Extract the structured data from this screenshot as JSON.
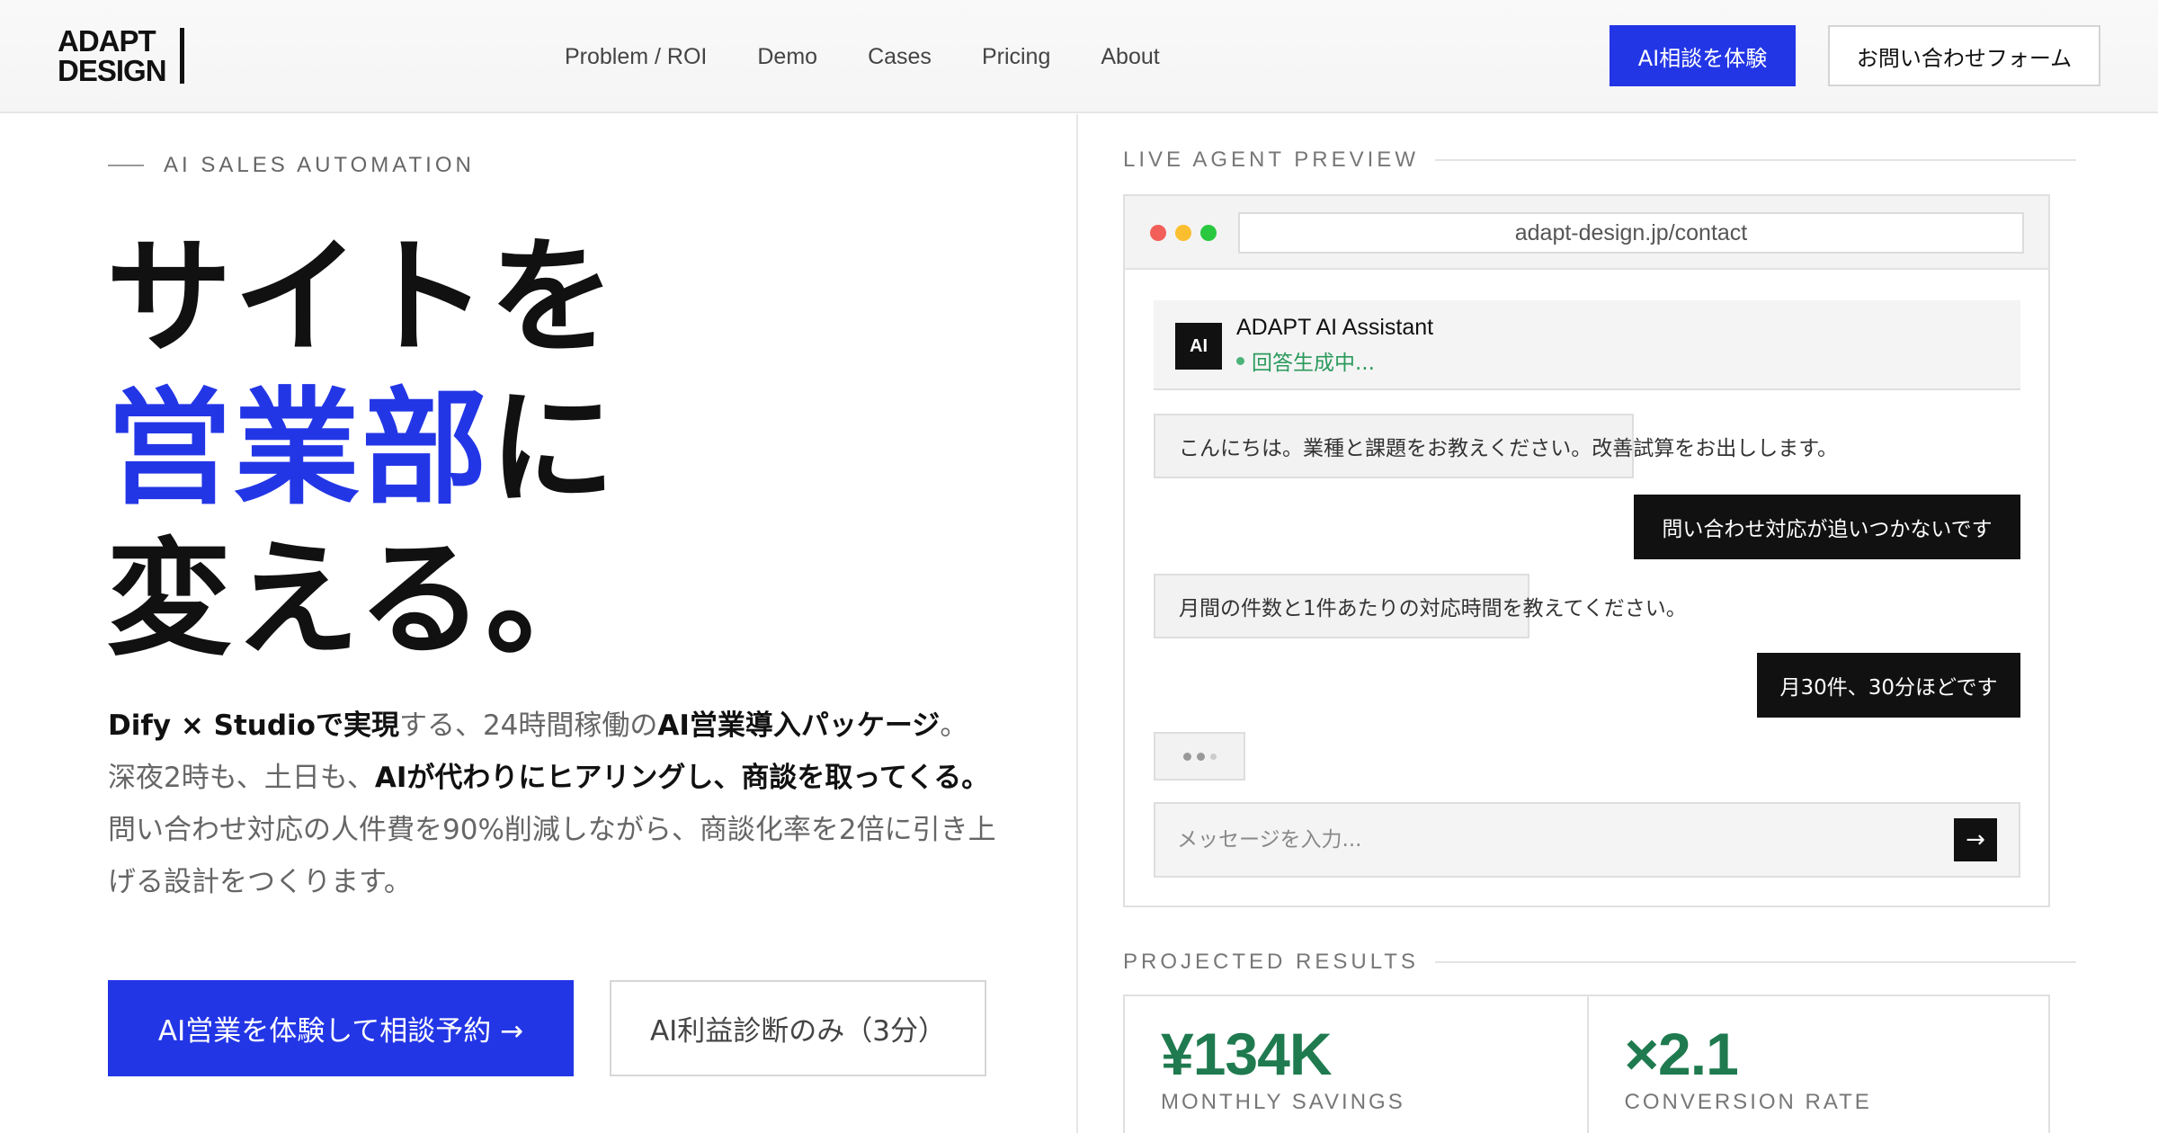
{
  "header": {
    "logo_line1": "ADAPT",
    "logo_line2": "DESIGN",
    "nav": [
      "Problem / ROI",
      "Demo",
      "Cases",
      "Pricing",
      "About"
    ],
    "cta_primary": "AI相談を体験",
    "cta_secondary": "お問い合わせフォーム"
  },
  "hero": {
    "eyebrow": "AI SALES AUTOMATION",
    "headline_line1": "サイトを",
    "headline_accent": "営業部",
    "headline_line2_rest": "に",
    "headline_line3": "変える。",
    "desc": {
      "p1_bold_a": "Dify × Studioで実現",
      "p1_mid": "する、24時間稼働の",
      "p1_bold_b": "AI営業導入パッケージ",
      "p1_end": "。",
      "p2_start": "深夜2時も、土日も、",
      "p2_bold": "AIが代わりにヒアリングし、商談を取ってくる。",
      "p3": "問い合わせ対応の人件費を90%削減しながら、商談化率を2倍に引き上",
      "p4": "げる設計をつくります。"
    },
    "cta_primary": "AI営業を体験して相談予約 →",
    "cta_secondary": "AI利益診断のみ（3分）"
  },
  "preview": {
    "label": "LIVE AGENT PREVIEW",
    "url": "adapt-design.jp/contact",
    "agent_avatar": "AI",
    "agent_name": "ADAPT AI Assistant",
    "agent_status": "回答生成中...",
    "messages": [
      {
        "role": "ai",
        "text": "こんにちは。業種と課題をお教えください。改善試算をお出しします。"
      },
      {
        "role": "user",
        "text": "問い合わせ対応が追いつかないです"
      },
      {
        "role": "ai",
        "text": "月間の件数と1件あたりの対応時間を教えてください。"
      },
      {
        "role": "user",
        "text": "月30件、30分ほどです"
      }
    ],
    "input_placeholder": "メッセージを入力...",
    "send_icon": "→"
  },
  "results": {
    "label": "PROJECTED RESULTS",
    "items": [
      {
        "value": "¥134K",
        "label": "MONTHLY SAVINGS"
      },
      {
        "value": "×2.1",
        "label": "CONVERSION RATE"
      }
    ]
  },
  "colors": {
    "accent": "#2336e6",
    "success": "#1f7a4f",
    "dark": "#111111",
    "window_red": "#f25f58",
    "window_yellow": "#fbbe2f",
    "window_green": "#2ac840"
  }
}
